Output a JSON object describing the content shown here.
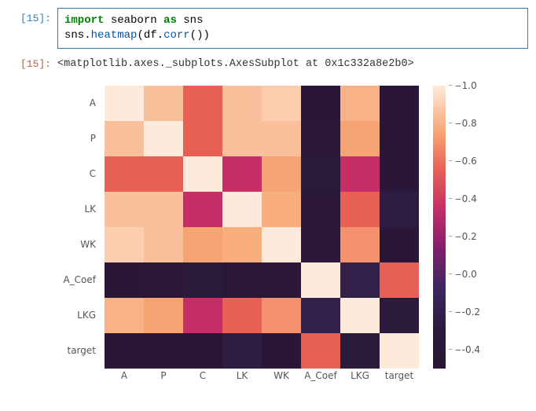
{
  "input_prompt": "[15]:",
  "output_prompt": "[15]:",
  "code_tokens": [
    {
      "t": "import",
      "c": "kw"
    },
    {
      "t": " "
    },
    {
      "t": "seaborn",
      "c": "nm"
    },
    {
      "t": " "
    },
    {
      "t": "as",
      "c": "kw"
    },
    {
      "t": " "
    },
    {
      "t": "sns",
      "c": "nm"
    },
    {
      "t": "\n"
    },
    {
      "t": "sns",
      "c": "nm"
    },
    {
      "t": ".",
      "c": "nm"
    },
    {
      "t": "heatmap",
      "c": "fn"
    },
    {
      "t": "(df",
      "c": "nm"
    },
    {
      "t": ".",
      "c": "nm"
    },
    {
      "t": "corr",
      "c": "fn"
    },
    {
      "t": "())",
      "c": "nm"
    }
  ],
  "output_text": "<matplotlib.axes._subplots.AxesSubplot at 0x1c332a8e2b0>",
  "chart_data": {
    "type": "heatmap",
    "title": "",
    "xlabel": "",
    "ylabel": "",
    "categories": [
      "A",
      "P",
      "C",
      "LK",
      "WK",
      "A_Coef",
      "LKG",
      "target"
    ],
    "matrix": [
      [
        1.0,
        0.85,
        0.55,
        0.85,
        0.9,
        -0.45,
        0.8,
        -0.5
      ],
      [
        0.85,
        1.0,
        0.55,
        0.85,
        0.85,
        -0.4,
        0.75,
        -0.45
      ],
      [
        0.55,
        0.55,
        1.0,
        0.35,
        0.75,
        -0.3,
        0.35,
        -0.5
      ],
      [
        0.85,
        0.85,
        0.35,
        1.0,
        0.78,
        -0.42,
        0.55,
        -0.25
      ],
      [
        0.9,
        0.85,
        0.75,
        0.78,
        1.0,
        -0.4,
        0.7,
        -0.48
      ],
      [
        -0.45,
        -0.4,
        -0.3,
        -0.42,
        -0.4,
        1.0,
        -0.2,
        0.55
      ],
      [
        0.8,
        0.75,
        0.35,
        0.55,
        0.7,
        -0.2,
        1.0,
        -0.3
      ],
      [
        -0.5,
        -0.45,
        -0.5,
        -0.25,
        -0.48,
        0.55,
        -0.3,
        1.0
      ]
    ],
    "colorbar_ticks": [
      "-0.4",
      "-0.2",
      "0.0",
      "0.2",
      "0.4",
      "0.6",
      "0.8",
      "1.0"
    ],
    "vmin": -0.5,
    "vmax": 1.0
  }
}
